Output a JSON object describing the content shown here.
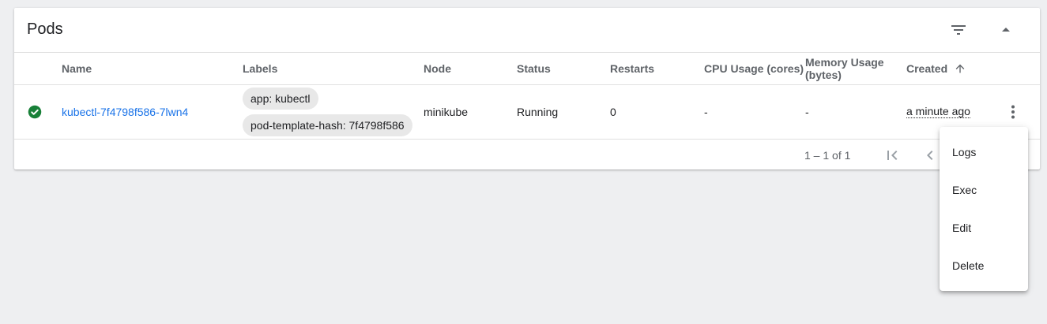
{
  "card": {
    "title": "Pods"
  },
  "table": {
    "columns": {
      "name": "Name",
      "labels": "Labels",
      "node": "Node",
      "status": "Status",
      "restarts": "Restarts",
      "cpu": "CPU Usage (cores)",
      "memory_line1": "Memory Usage",
      "memory_line2": "(bytes)",
      "created": "Created"
    },
    "rows": [
      {
        "status_color": "#188038",
        "name": "kubectl-7f4798f586-7lwn4",
        "labels": [
          "app: kubectl",
          "pod-template-hash: 7f4798f586"
        ],
        "node": "minikube",
        "status": "Running",
        "restarts": "0",
        "cpu": "-",
        "memory": "-",
        "created": "a minute ago"
      }
    ]
  },
  "pagination": {
    "range": "1 – 1 of 1"
  },
  "menu": {
    "items": [
      "Logs",
      "Exec",
      "Edit",
      "Delete"
    ]
  },
  "icons": {
    "filter": "filter-icon",
    "collapse": "arrow-drop-up-icon",
    "sort": "arrow-up-icon",
    "status": "check-circle-icon",
    "actions": "more-vert-icon",
    "first_page": "first-page-icon",
    "prev_page": "chevron-left-icon"
  },
  "colors": {
    "link": "#1a73e8",
    "success": "#188038",
    "background": "#eeeff1"
  }
}
